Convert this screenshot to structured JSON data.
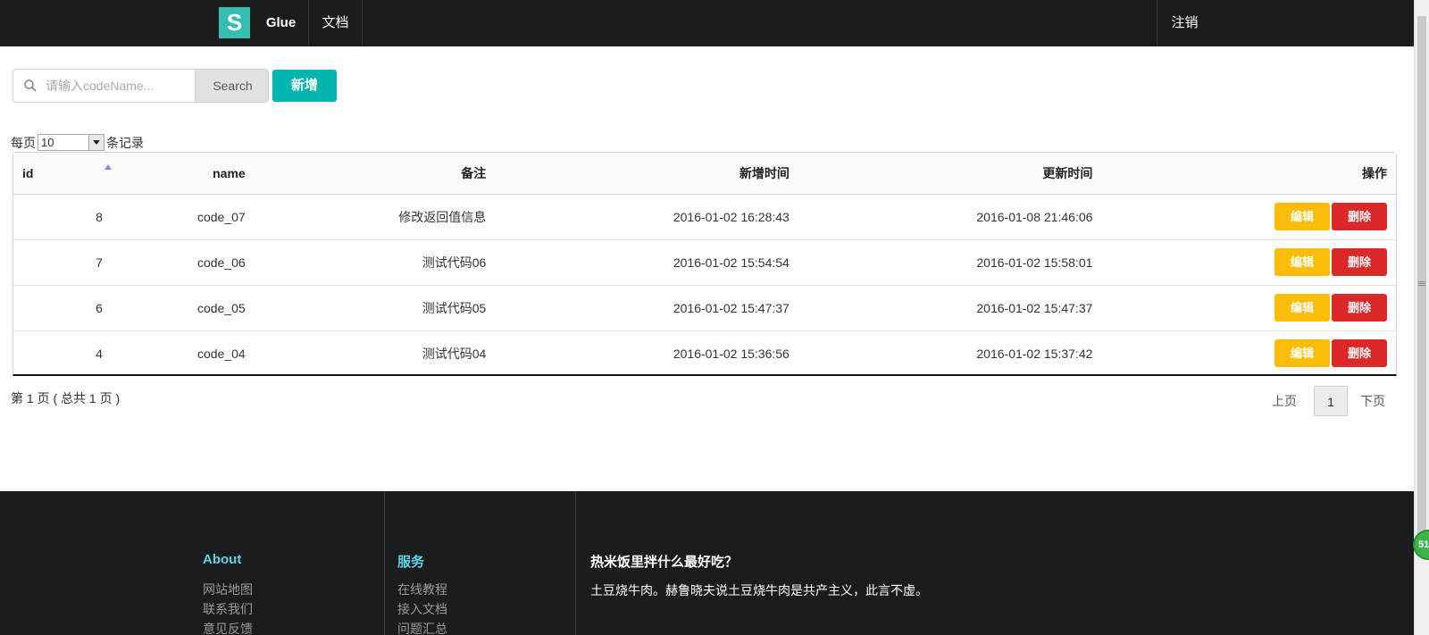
{
  "topbar": {
    "logo_letter": "S",
    "nav_glue": "Glue",
    "nav_docs": "文档",
    "nav_logout": "注销"
  },
  "toolbar": {
    "search_placeholder": "请输入codeName...",
    "search_label": "Search",
    "add_label": "新增"
  },
  "length": {
    "prefix": "每页",
    "value": "10",
    "suffix": "条记录"
  },
  "table": {
    "headers": {
      "id": "id",
      "name": "name",
      "note": "备注",
      "create_time": "新增时间",
      "update_time": "更新时间",
      "ops": "操作"
    },
    "rows": [
      {
        "id": "8",
        "name": "code_07",
        "note": "修改返回值信息",
        "create_time": "2016-01-02 16:28:43",
        "update_time": "2016-01-08 21:46:06",
        "edit": "编辑",
        "delete": "删除"
      },
      {
        "id": "7",
        "name": "code_06",
        "note": "测试代码06",
        "create_time": "2016-01-02 15:54:54",
        "update_time": "2016-01-02 15:58:01",
        "edit": "编辑",
        "delete": "删除"
      },
      {
        "id": "6",
        "name": "code_05",
        "note": "测试代码05",
        "create_time": "2016-01-02 15:47:37",
        "update_time": "2016-01-02 15:47:37",
        "edit": "编辑",
        "delete": "删除"
      },
      {
        "id": "4",
        "name": "code_04",
        "note": "测试代码04",
        "create_time": "2016-01-02 15:36:56",
        "update_time": "2016-01-02 15:37:42",
        "edit": "编辑",
        "delete": "删除"
      }
    ]
  },
  "pager": {
    "info": "第 1 页 ( 总共 1 页 )",
    "prev": "上页",
    "current": "1",
    "next": "下页"
  },
  "footer": {
    "about_title": "About",
    "about_links": [
      "网站地图",
      "联系我们",
      "意见反馈"
    ],
    "service_title": "服务",
    "service_links": [
      "在线教程",
      "接入文档",
      "问题汇总"
    ],
    "text_title": "热米饭里拌什么最好吃？",
    "text_body": "土豆烧牛肉。赫鲁晓夫说土豆烧牛肉是共产主义，此言不虚。"
  },
  "floating_badge": "51",
  "colors": {
    "topbar_bg": "#1b1c1d",
    "teal": "#00b5ad",
    "edit_yellow": "#fbbd08",
    "delete_red": "#db2828",
    "footer_link_head": "#5fd5e4"
  }
}
